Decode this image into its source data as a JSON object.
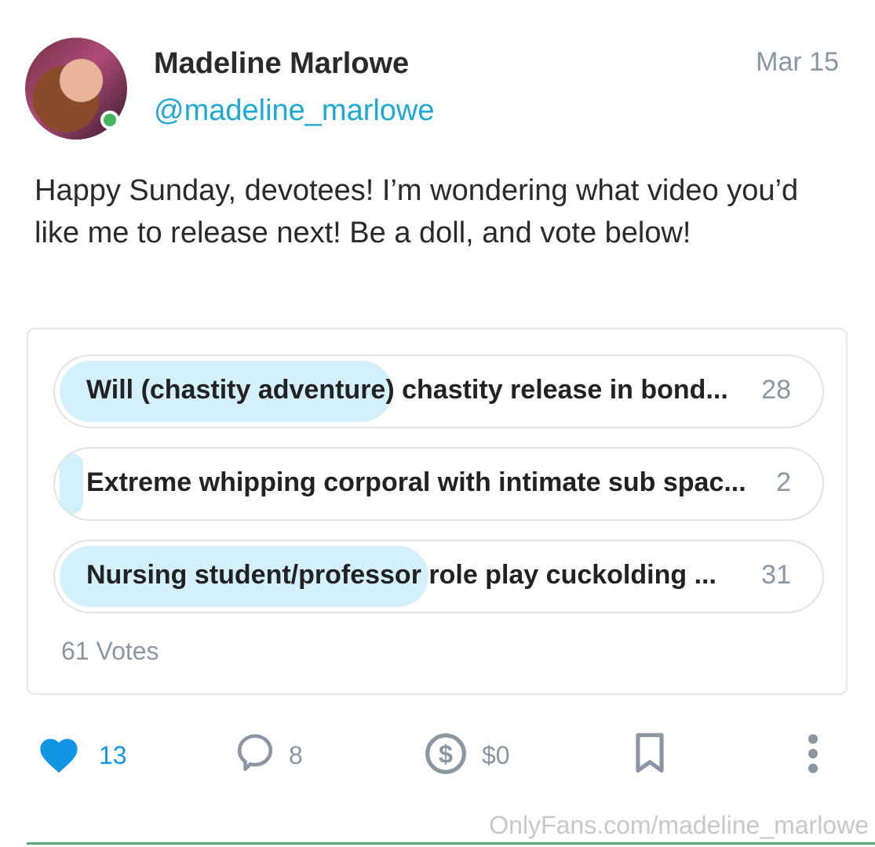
{
  "post": {
    "author": {
      "display_name": "Madeline Marlowe",
      "handle": "@madeline_marlowe",
      "online": true
    },
    "date": "Mar 15",
    "text": "Happy Sunday, devotees! I’m wondering what video you’d like me to release next! Be a doll, and vote below!"
  },
  "poll": {
    "options": [
      {
        "label": "Will (chastity adventure) chastity release in bond...",
        "votes": "28",
        "fraction": 0.46
      },
      {
        "label": "Extreme whipping corporal with intimate sub spac...",
        "votes": "2",
        "fraction": 0.03
      },
      {
        "label": "Nursing student/professor role play cuckolding ...",
        "votes": "31",
        "fraction": 0.51
      }
    ],
    "total": "61 Votes"
  },
  "actions": {
    "likes": "13",
    "comments": "8",
    "tips": "$0"
  },
  "colors": {
    "accent": "#1ea8d8",
    "like": "#1196e6",
    "muted": "#8a96a3",
    "poll_fill": "#d4f0fb",
    "online": "#3fb75a"
  },
  "watermark": "OnlyFans.com/madeline_marlowe"
}
